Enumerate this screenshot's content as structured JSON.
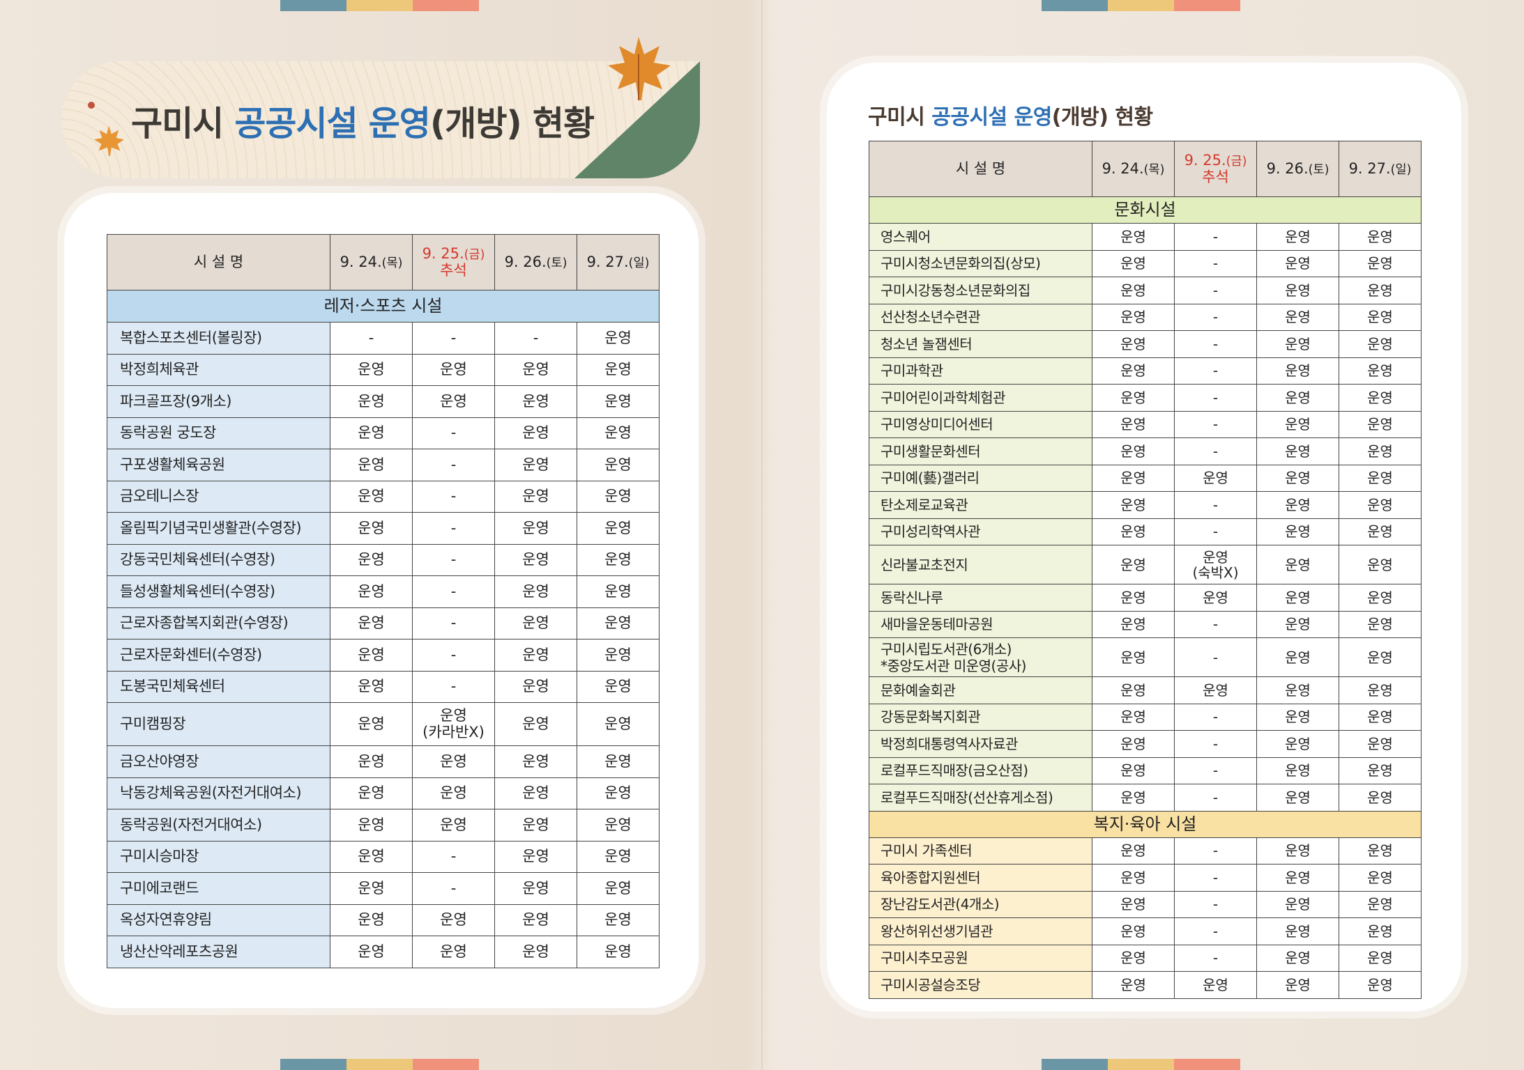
{
  "title": {
    "prefix": "구미시 ",
    "highlight": "공공시설 운영",
    "suffix": "(개방) 현황"
  },
  "colors": {
    "highlight_blue": "#2d6fb3",
    "holiday_red": "#d43a2c",
    "leisure_category": "#bcd9ee",
    "culture_category": "#e3eebe",
    "welfare_category": "#f9e0a3",
    "banner_green": "#5f8467"
  },
  "icons": [
    "maple-leaf-icon"
  ],
  "header": {
    "facility": "시 설 명",
    "dates": [
      {
        "date": "9. 24.",
        "day": "(목)",
        "note": "",
        "holiday": false
      },
      {
        "date": "9. 25.",
        "day": "(금)",
        "note": "추석",
        "holiday": true
      },
      {
        "date": "9. 26.",
        "day": "(토)",
        "note": "",
        "holiday": false
      },
      {
        "date": "9. 27.",
        "day": "(일)",
        "note": "",
        "holiday": false
      }
    ]
  },
  "left_table": {
    "category": "레저·스포츠 시설",
    "rows": [
      {
        "name": "복합스포츠센터(볼링장)",
        "status": [
          "-",
          "-",
          "-",
          "운영"
        ]
      },
      {
        "name": "박정희체육관",
        "status": [
          "운영",
          "운영",
          "운영",
          "운영"
        ]
      },
      {
        "name": "파크골프장(9개소)",
        "status": [
          "운영",
          "운영",
          "운영",
          "운영"
        ]
      },
      {
        "name": "동락공원 궁도장",
        "status": [
          "운영",
          "-",
          "운영",
          "운영"
        ]
      },
      {
        "name": "구포생활체육공원",
        "status": [
          "운영",
          "-",
          "운영",
          "운영"
        ]
      },
      {
        "name": "금오테니스장",
        "status": [
          "운영",
          "-",
          "운영",
          "운영"
        ]
      },
      {
        "name": "올림픽기념국민생활관(수영장)",
        "status": [
          "운영",
          "-",
          "운영",
          "운영"
        ]
      },
      {
        "name": "강동국민체육센터(수영장)",
        "status": [
          "운영",
          "-",
          "운영",
          "운영"
        ]
      },
      {
        "name": "들성생활체육센터(수영장)",
        "status": [
          "운영",
          "-",
          "운영",
          "운영"
        ]
      },
      {
        "name": "근로자종합복지회관(수영장)",
        "status": [
          "운영",
          "-",
          "운영",
          "운영"
        ]
      },
      {
        "name": "근로자문화센터(수영장)",
        "status": [
          "운영",
          "-",
          "운영",
          "운영"
        ]
      },
      {
        "name": "도봉국민체육센터",
        "status": [
          "운영",
          "-",
          "운영",
          "운영"
        ]
      },
      {
        "name": "구미캠핑장",
        "status": [
          "운영",
          "운영\n(카라반X)",
          "운영",
          "운영"
        ]
      },
      {
        "name": "금오산야영장",
        "status": [
          "운영",
          "운영",
          "운영",
          "운영"
        ]
      },
      {
        "name": "낙동강체육공원(자전거대여소)",
        "status": [
          "운영",
          "운영",
          "운영",
          "운영"
        ]
      },
      {
        "name": "동락공원(자전거대여소)",
        "status": [
          "운영",
          "운영",
          "운영",
          "운영"
        ]
      },
      {
        "name": "구미시승마장",
        "status": [
          "운영",
          "-",
          "운영",
          "운영"
        ]
      },
      {
        "name": "구미에코랜드",
        "status": [
          "운영",
          "-",
          "운영",
          "운영"
        ]
      },
      {
        "name": "옥성자연휴양림",
        "status": [
          "운영",
          "운영",
          "운영",
          "운영"
        ]
      },
      {
        "name": "냉산산악레포츠공원",
        "status": [
          "운영",
          "운영",
          "운영",
          "운영"
        ]
      }
    ]
  },
  "right_table": {
    "culture_category": "문화시설",
    "culture_rows": [
      {
        "name": "영스퀘어",
        "status": [
          "운영",
          "-",
          "운영",
          "운영"
        ]
      },
      {
        "name": "구미시청소년문화의집(상모)",
        "status": [
          "운영",
          "-",
          "운영",
          "운영"
        ]
      },
      {
        "name": "구미시강동청소년문화의집",
        "status": [
          "운영",
          "-",
          "운영",
          "운영"
        ]
      },
      {
        "name": "선산청소년수련관",
        "status": [
          "운영",
          "-",
          "운영",
          "운영"
        ]
      },
      {
        "name": "청소년 놀잼센터",
        "status": [
          "운영",
          "-",
          "운영",
          "운영"
        ]
      },
      {
        "name": "구미과학관",
        "status": [
          "운영",
          "-",
          "운영",
          "운영"
        ]
      },
      {
        "name": "구미어린이과학체험관",
        "status": [
          "운영",
          "-",
          "운영",
          "운영"
        ]
      },
      {
        "name": "구미영상미디어센터",
        "status": [
          "운영",
          "-",
          "운영",
          "운영"
        ]
      },
      {
        "name": "구미생활문화센터",
        "status": [
          "운영",
          "-",
          "운영",
          "운영"
        ]
      },
      {
        "name": "구미예(藝)갤러리",
        "status": [
          "운영",
          "운영",
          "운영",
          "운영"
        ]
      },
      {
        "name": "탄소제로교육관",
        "status": [
          "운영",
          "-",
          "운영",
          "운영"
        ]
      },
      {
        "name": "구미성리학역사관",
        "status": [
          "운영",
          "-",
          "운영",
          "운영"
        ]
      },
      {
        "name": "신라불교초전지",
        "status": [
          "운영",
          "운영\n(숙박X)",
          "운영",
          "운영"
        ]
      },
      {
        "name": "동락신나루",
        "status": [
          "운영",
          "운영",
          "운영",
          "운영"
        ]
      },
      {
        "name": "새마을운동테마공원",
        "status": [
          "운영",
          "-",
          "운영",
          "운영"
        ]
      },
      {
        "name": "구미시립도서관(6개소)\n*중앙도서관 미운영(공사)",
        "status": [
          "운영",
          "-",
          "운영",
          "운영"
        ]
      },
      {
        "name": "문화예술회관",
        "status": [
          "운영",
          "운영",
          "운영",
          "운영"
        ]
      },
      {
        "name": "강동문화복지회관",
        "status": [
          "운영",
          "-",
          "운영",
          "운영"
        ]
      },
      {
        "name": "박정희대통령역사자료관",
        "status": [
          "운영",
          "-",
          "운영",
          "운영"
        ]
      },
      {
        "name": "로컬푸드직매장(금오산점)",
        "status": [
          "운영",
          "-",
          "운영",
          "운영"
        ]
      },
      {
        "name": "로컬푸드직매장(선산휴게소점)",
        "status": [
          "운영",
          "-",
          "운영",
          "운영"
        ]
      }
    ],
    "welfare_category": "복지·육아 시설",
    "welfare_rows": [
      {
        "name": "구미시 가족센터",
        "status": [
          "운영",
          "-",
          "운영",
          "운영"
        ]
      },
      {
        "name": "육아종합지원센터",
        "status": [
          "운영",
          "-",
          "운영",
          "운영"
        ]
      },
      {
        "name": "장난감도서관(4개소)",
        "status": [
          "운영",
          "-",
          "운영",
          "운영"
        ]
      },
      {
        "name": "왕산허위선생기념관",
        "status": [
          "운영",
          "-",
          "운영",
          "운영"
        ]
      },
      {
        "name": "구미시추모공원",
        "status": [
          "운영",
          "-",
          "운영",
          "운영"
        ]
      },
      {
        "name": "구미시공설승조당",
        "status": [
          "운영",
          "운영",
          "운영",
          "운영"
        ]
      }
    ]
  }
}
